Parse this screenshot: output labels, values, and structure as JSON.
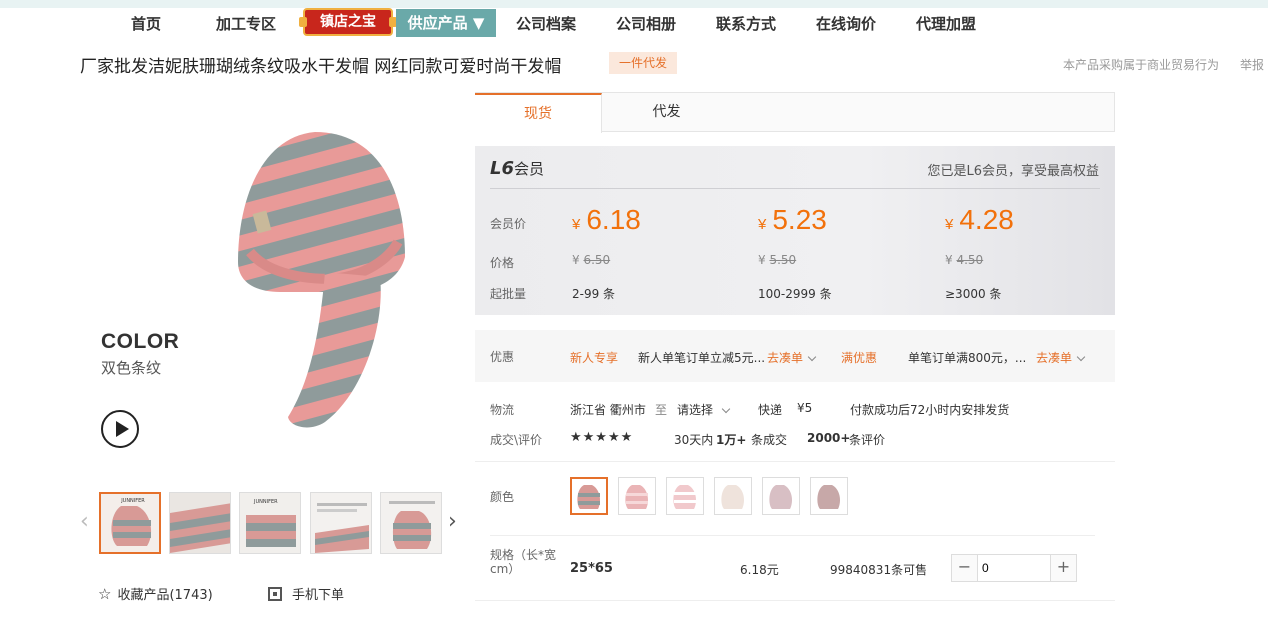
{
  "nav": {
    "items": [
      "首页",
      "加工专区",
      "公司档案",
      "公司相册",
      "联系方式",
      "在线询价",
      "代理加盟"
    ],
    "badge": "镇店之宝",
    "active": "供应产品 ▼"
  },
  "product": {
    "title": "厂家批发洁妮肤珊瑚绒条纹吸水干发帽 网红同款可爱时尚干发帽",
    "tag": "一件代发",
    "note": "本产品采购属于商业贸易行为",
    "report": "举报"
  },
  "image": {
    "color_en": "COLOR",
    "color_cn": "双色条纹"
  },
  "gallery": {
    "thumb_text": "JUNNIFER"
  },
  "actions": {
    "favorite": "收藏产品(1743)",
    "mobile": "手机下单"
  },
  "tabs": [
    "现货",
    "代发"
  ],
  "member": {
    "level": "L6",
    "level_suffix": "会员",
    "note": "您已是L6会员，享受最高权益",
    "labels": {
      "member_price": "会员价",
      "price": "价格",
      "batch": "起批量"
    },
    "currency": "¥",
    "tiers": [
      {
        "member_price": "6.18",
        "price": "6.50",
        "qty": "2-99 条"
      },
      {
        "member_price": "5.23",
        "price": "5.50",
        "qty": "100-2999 条"
      },
      {
        "member_price": "4.28",
        "price": "4.50",
        "qty": "≥3000 条"
      }
    ]
  },
  "promo": {
    "label": "优惠",
    "p1_tag": "新人专享",
    "p1_text": "新人单笔订单立减5元...",
    "p1_link": "去凑单",
    "p2_tag": "满优惠",
    "p2_text": "单笔订单满800元，...",
    "p2_link": "去凑单"
  },
  "logistics": {
    "label": "物流",
    "from": "浙江省 衢州市",
    "to": "至",
    "select": "请选择",
    "express": "快递",
    "fee": "¥5",
    "ship": "付款成功后72小时内安排发货"
  },
  "deals": {
    "label": "成交\\评价",
    "stars": "★★★★★",
    "sales_pre": "30天内",
    "sales_num": "1万+",
    "sales_post": "条成交",
    "reviews_num": "2000+",
    "reviews_post": "条评价"
  },
  "color": {
    "label": "颜色",
    "swatch_count": 6
  },
  "spec": {
    "label": "规格（长*宽cm）",
    "value": "25*65",
    "price": "6.18元",
    "stock": "99840831条可售",
    "qty": "0"
  }
}
